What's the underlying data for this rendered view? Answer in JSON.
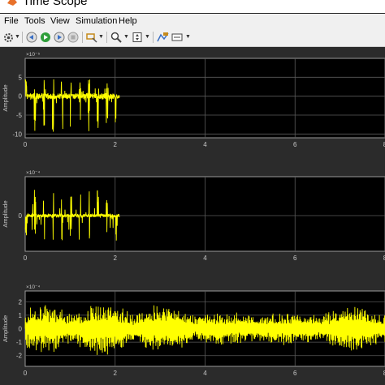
{
  "window": {
    "title": "Time Scope"
  },
  "menu": [
    "File",
    "Tools",
    "View",
    "Simulation",
    "Help"
  ],
  "toolbar_icons": [
    "gear-icon",
    "rewind-icon",
    "run-icon",
    "step-forward-icon",
    "stop-icon",
    "highlight-icon",
    "zoom-icon",
    "scale-axes-icon",
    "measurements-icon"
  ],
  "colors": {
    "trace": "#ffff00",
    "plot_bg": "#000000",
    "figure_bg": "#2b2b2b",
    "grid": "#5a5a5a"
  },
  "chart_data": [
    {
      "type": "line",
      "ylabel": "Amplitude",
      "exponent_label": "×10⁻⁵",
      "xlim": [
        0,
        8
      ],
      "ylim": [
        -11,
        10
      ],
      "x_ticks": [
        "0",
        "2",
        "4",
        "6",
        "8"
      ],
      "y_ticks": [
        "5",
        "0",
        "-5",
        "-10"
      ],
      "y_tick_values": [
        5,
        0,
        -5,
        -10
      ],
      "signal": {
        "x_end": 2.1,
        "peak_positive": 4.5,
        "peak_negative": -9.5,
        "noise_floor": 0.8,
        "burst_period": 0.2
      }
    },
    {
      "type": "line",
      "ylabel": "Amplitude",
      "exponent_label": "×10⁻⁴",
      "xlim": [
        0,
        8
      ],
      "ylim": [
        -5.5,
        6
      ],
      "x_ticks": [
        "0",
        "2",
        "4",
        "6",
        "8"
      ],
      "y_ticks": [
        "0"
      ],
      "y_tick_values": [
        0
      ],
      "signal": {
        "x_end": 2.1,
        "peak_positive": 4.5,
        "peak_negative": -4.0,
        "noise_floor": 0.25,
        "burst_period": 0.2
      }
    },
    {
      "type": "line",
      "ylabel": "Amplitude",
      "exponent_label": "×10⁻⁴",
      "xlim": [
        0,
        8
      ],
      "ylim": [
        -2.8,
        2.8
      ],
      "x_ticks": [
        "0",
        "2",
        "4",
        "6",
        "8"
      ],
      "y_ticks": [
        "2",
        "1",
        "0",
        "-1",
        "-2"
      ],
      "y_tick_values": [
        2,
        1,
        0,
        -1,
        -2
      ],
      "signal": {
        "x_end": 8,
        "peak_positive": 2.0,
        "peak_negative": -2.2,
        "noise_floor": 0.15,
        "burst_period": 0
      }
    }
  ]
}
